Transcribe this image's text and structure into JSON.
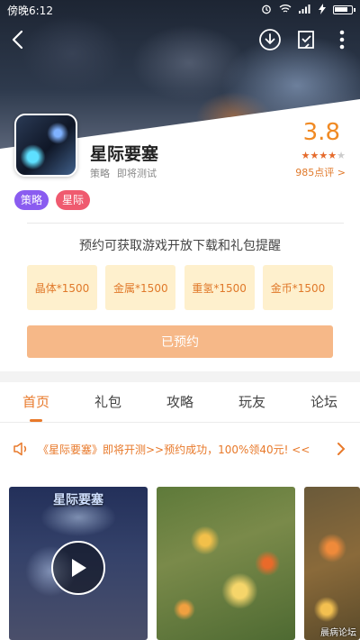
{
  "status_bar": {
    "time": "傍晚6:12"
  },
  "app": {
    "name": "星际要塞",
    "category": "策略",
    "stage": "即将测试",
    "score": "3.8",
    "rating_stars": 4,
    "reviews": "985点评 >"
  },
  "tags": [
    {
      "label": "策略",
      "color": "#8a5cf0"
    },
    {
      "label": "星际",
      "color": "#ef5a6f"
    }
  ],
  "notice": "预约可获取游戏开放下载和礼包提醒",
  "rewards": [
    "晶体*1500",
    "金属*1500",
    "重氢*1500",
    "金币*1500"
  ],
  "reserve_button": "已预约",
  "tabs": [
    {
      "label": "首页",
      "active": true
    },
    {
      "label": "礼包",
      "active": false
    },
    {
      "label": "攻略",
      "active": false
    },
    {
      "label": "玩友",
      "active": false
    },
    {
      "label": "论坛",
      "active": false
    }
  ],
  "marquee": "《星际要塞》即将开测>>预约成功，100%领40元! <<",
  "screenshots": {
    "first_title": "星际要塞",
    "watermark": "晨病论坛"
  },
  "colors": {
    "accent": "#e8792a",
    "reward_bg": "#fef0cd",
    "reserve_bg": "#f6b888"
  },
  "icons": [
    "back-icon",
    "download-icon",
    "reserve-list-icon",
    "more-icon",
    "speaker-icon",
    "chevron-right-icon",
    "play-icon"
  ]
}
